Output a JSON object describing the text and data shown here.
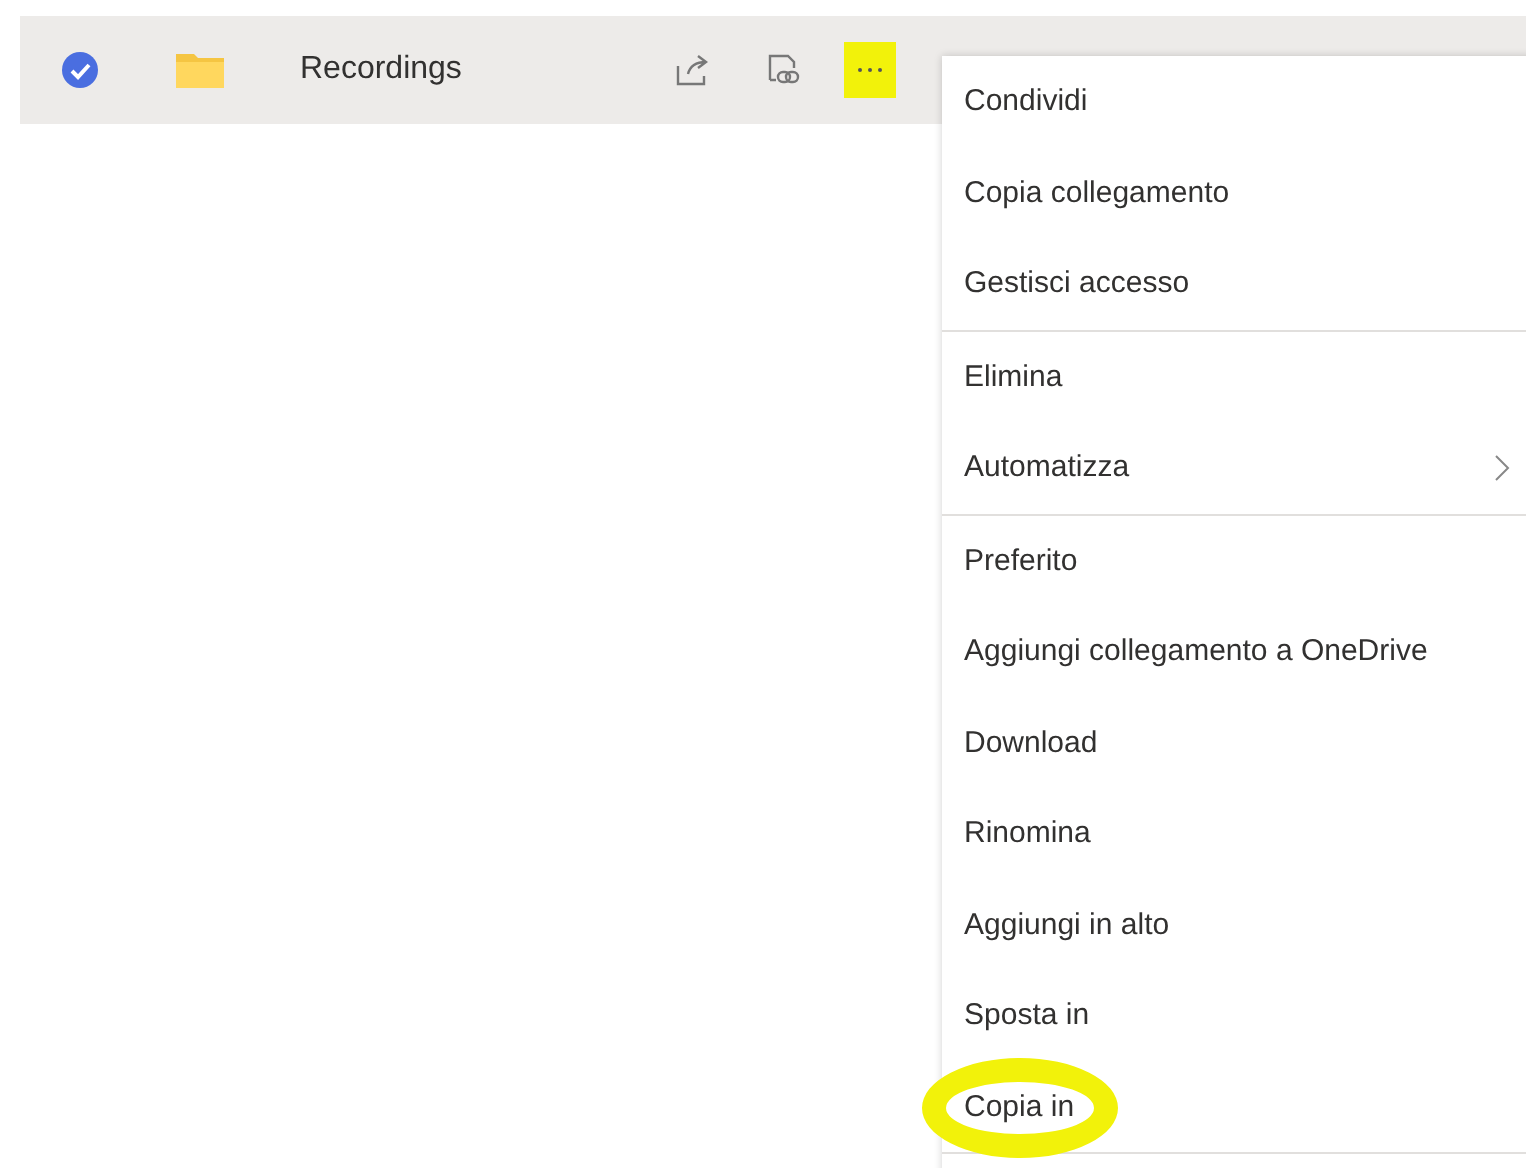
{
  "row": {
    "selected": true,
    "name": "Recordings"
  },
  "more_button": {
    "highlighted": true
  },
  "menu": {
    "sections": [
      [
        {
          "label": "Condividi",
          "highlighted": false,
          "submenu": false
        },
        {
          "label": "Copia collegamento",
          "highlighted": false,
          "submenu": false
        },
        {
          "label": "Gestisci accesso",
          "highlighted": false,
          "submenu": false
        }
      ],
      [
        {
          "label": "Elimina",
          "highlighted": false,
          "submenu": false
        },
        {
          "label": "Automatizza",
          "highlighted": false,
          "submenu": true
        }
      ],
      [
        {
          "label": "Preferito",
          "highlighted": false,
          "submenu": false
        },
        {
          "label": "Aggiungi collegamento a OneDrive",
          "highlighted": false,
          "submenu": false
        },
        {
          "label": "Download",
          "highlighted": false,
          "submenu": false
        },
        {
          "label": "Rinomina",
          "highlighted": false,
          "submenu": false
        },
        {
          "label": "Aggiungi in alto",
          "highlighted": false,
          "submenu": false
        },
        {
          "label": "Sposta in",
          "highlighted": false,
          "submenu": false
        },
        {
          "label": "Copia in",
          "highlighted": true,
          "submenu": false
        }
      ]
    ]
  }
}
